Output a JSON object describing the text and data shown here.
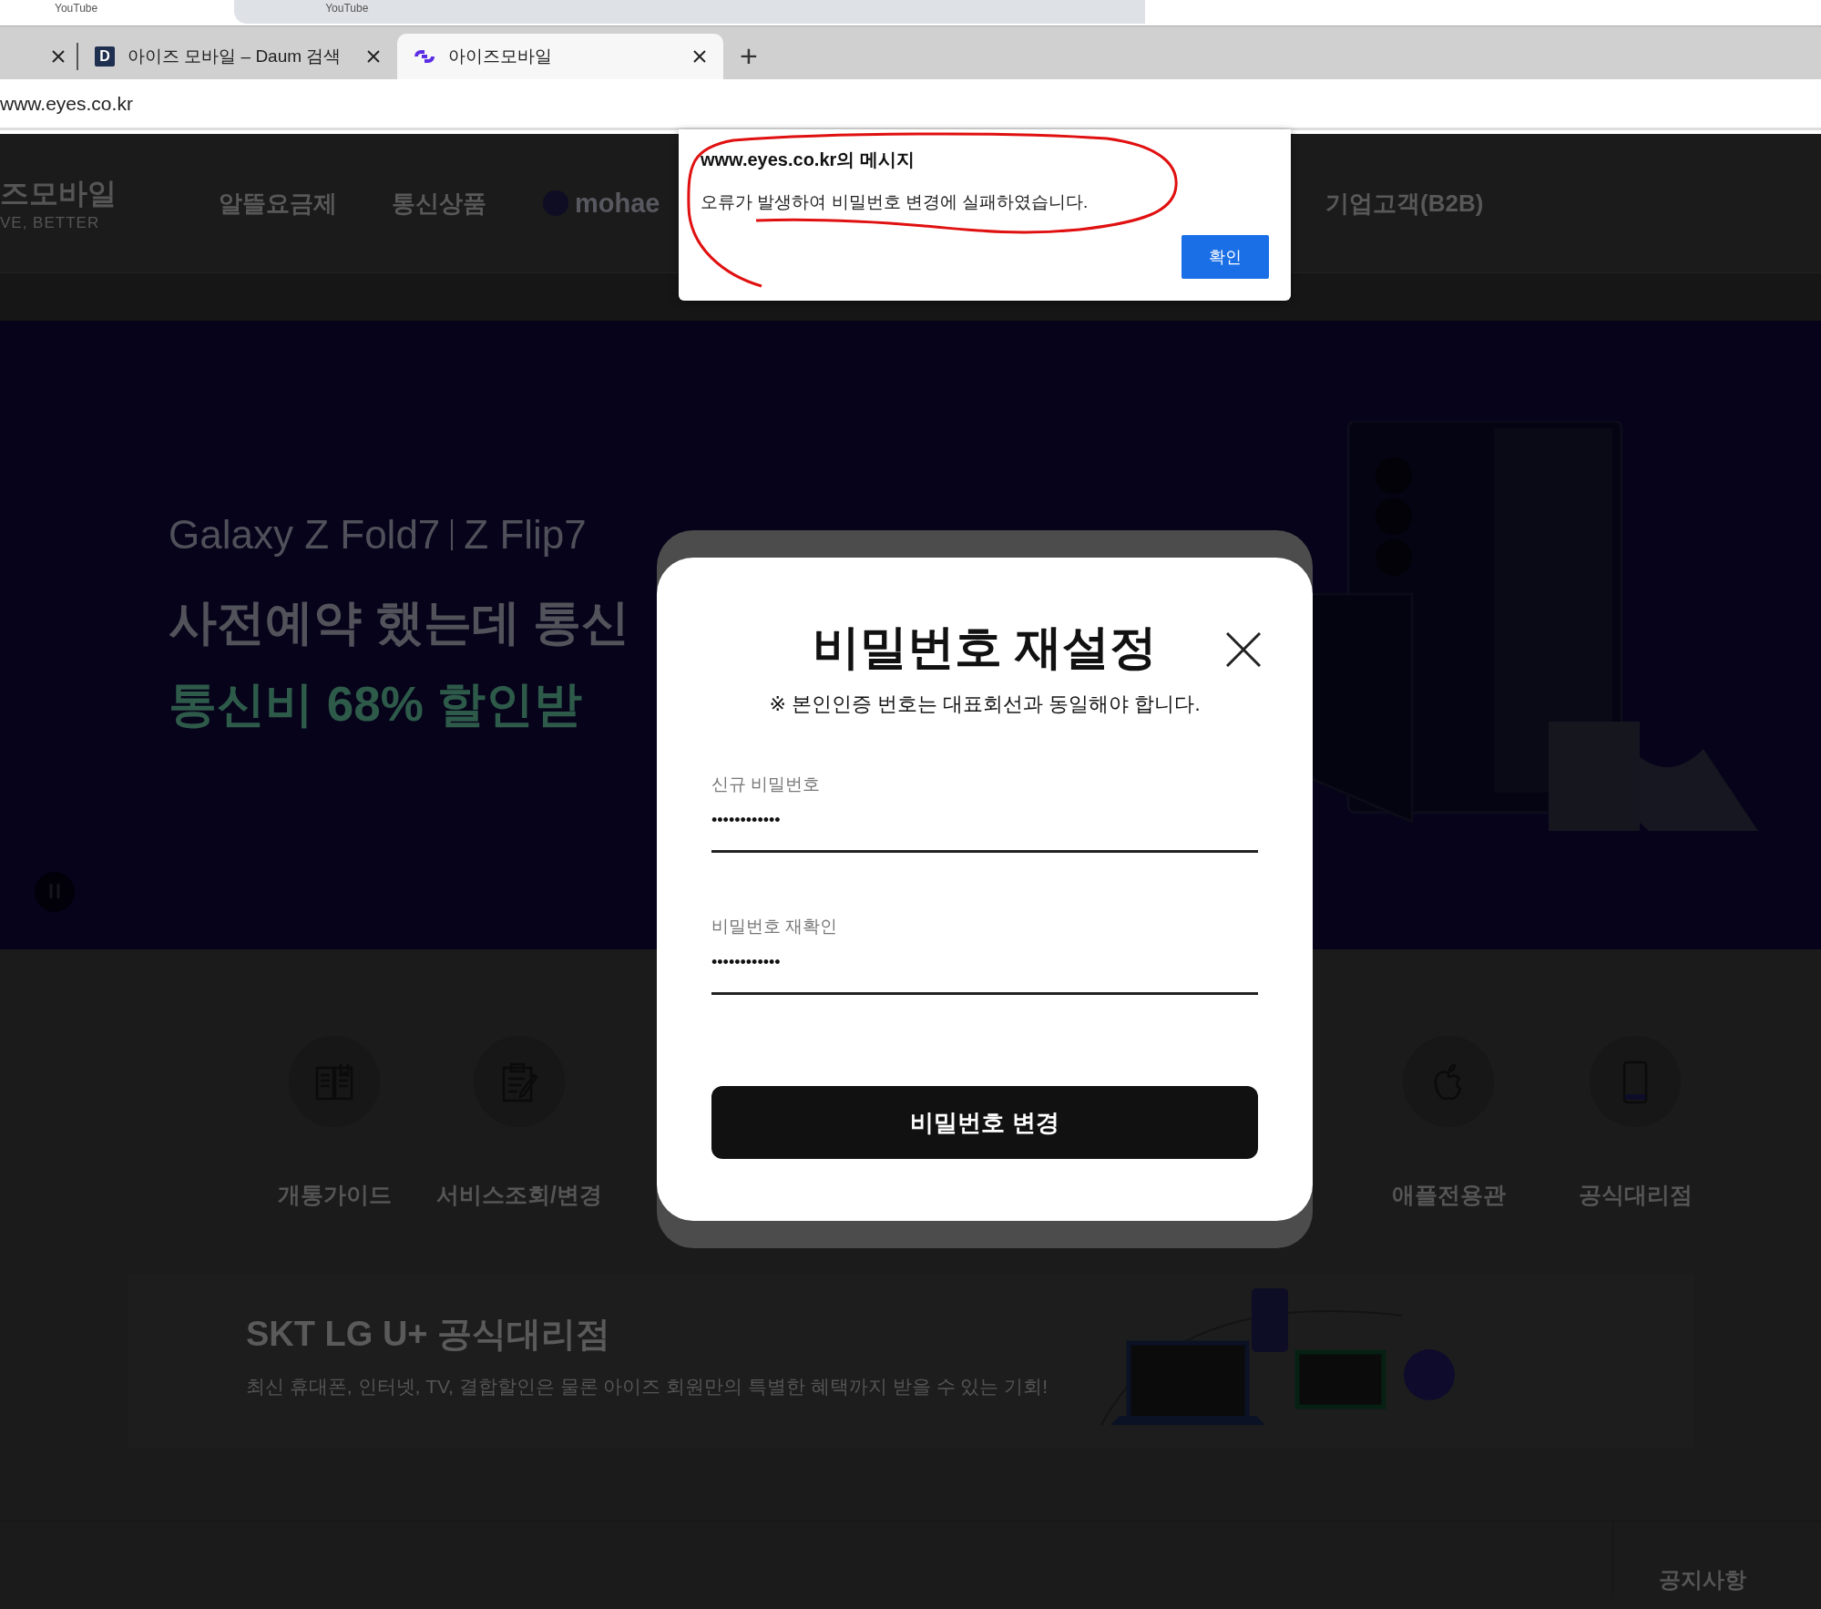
{
  "browser": {
    "background_tabs": [
      "YouTube",
      "YouTube"
    ],
    "tabs": [
      {
        "label": "아이즈 모바일 – Daum 검색",
        "favicon_text": "D",
        "selected": false
      },
      {
        "label": "아이즈모바일",
        "selected": true
      }
    ],
    "new_tab": "+",
    "address": "www.eyes.co.kr"
  },
  "site": {
    "logo": "즈모바일",
    "tagline": "VE, BETTER",
    "nav": [
      {
        "kind": "text",
        "label": "알뜰요금제"
      },
      {
        "kind": "text",
        "label": "통신상품"
      },
      {
        "kind": "brand",
        "label": "mohae"
      },
      {
        "kind": "text",
        "label": "기업고객(B2B)"
      }
    ],
    "hero": {
      "models": [
        "Galaxy Z Fold7",
        "Z Flip7"
      ],
      "headline": [
        "사전예약 했는데 통신",
        "통신비 68% 할인받"
      ]
    },
    "quick_menu": [
      {
        "kind": "book",
        "label": "개통가이드"
      },
      {
        "kind": "clipboard",
        "label": "서비스조회/변경"
      },
      {
        "kind": "apple",
        "label": "애플전용관"
      },
      {
        "kind": "phone",
        "label": "공식대리점"
      }
    ],
    "promo": {
      "title": "SKT LG U+ 공식대리점",
      "text": "최신 휴대폰, 인터넷, TV, 결합할인은 물론 아이즈 회원만의 특별한 혜택까지 받을 수 있는 기회!"
    },
    "notice": "공지사항"
  },
  "modal": {
    "title": "비밀번호 재설정",
    "note": "※ 본인인증 번호는 대표회선과 동일해야 합니다.",
    "fields": [
      {
        "label": "신규 비밀번호",
        "value": "••••••••••••"
      },
      {
        "label": "비밀번호 재확인",
        "value": "••••••••••••"
      }
    ],
    "submit": "비밀번호 변경"
  },
  "alert": {
    "title": "www.eyes.co.kr의 메시지",
    "message": "오류가 발생하여 비밀번호 변경에 실패하였습니다.",
    "button": "확인"
  }
}
